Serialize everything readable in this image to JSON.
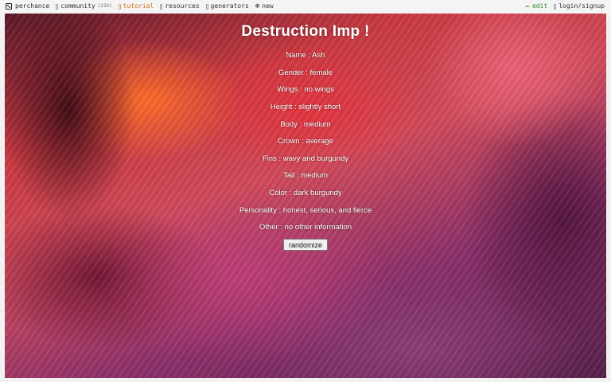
{
  "nav": {
    "perchance_label": "perchance",
    "community_label": "community",
    "community_count": "(21h)",
    "tutorial_label": "tutorial",
    "resources_label": "resources",
    "generators_label": "generators",
    "new_label": "new",
    "edit_label": "edit",
    "login_label": "login/signup"
  },
  "generator": {
    "title": "Destruction Imp !",
    "attributes": [
      "Name : Ash",
      "Gender : female",
      "Wings : no wings",
      "Height : slightly short",
      "Body : medium",
      "Crown : average",
      "Fins : wavy and burgundy",
      "Tail : medium",
      "Color : dark burgundy",
      "Personality : honest, serious, and fierce",
      "Other : no other information"
    ],
    "button_label": "randomize"
  },
  "colors": {
    "tutorial": "#d4711c",
    "edit": "#2d8c2d"
  }
}
